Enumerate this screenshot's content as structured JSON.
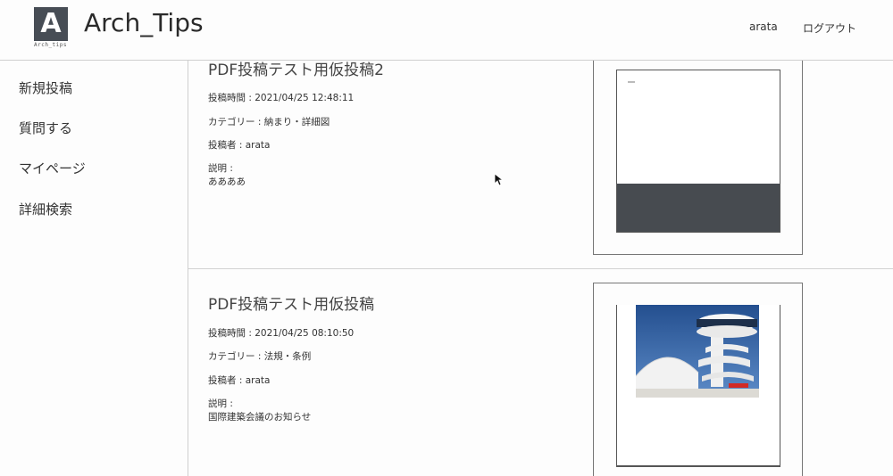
{
  "header": {
    "logo_letter": "A",
    "logo_sub": "Arch_tips",
    "site_title": "Arch_Tips",
    "user": "arata",
    "logout": "ログアウト"
  },
  "sidebar": {
    "items": [
      {
        "label": "新規投稿"
      },
      {
        "label": "質問する"
      },
      {
        "label": "マイページ"
      },
      {
        "label": "詳細検索"
      }
    ]
  },
  "posts": [
    {
      "title": "PDF投稿テスト用仮投稿2",
      "posted_at": "投稿時間 : 2021/04/25 12:48:11",
      "category": "カテゴリー : 納まり・詳細図",
      "author": "投稿者 : arata",
      "desc_label": "説明 :",
      "desc": "ああああ"
    },
    {
      "title": "PDF投稿テスト用仮投稿",
      "posted_at": "投稿時間 : 2021/04/25 08:10:50",
      "category": "カテゴリー : 法規・条例",
      "author": "投稿者 : arata",
      "desc_label": "説明 :",
      "desc": "国際建築会議のお知らせ"
    }
  ],
  "colors": {
    "logo_bg": "#474d55",
    "thumb_dark_band": "#474b50",
    "sky": "#2e63a8",
    "sign": "#d22a25"
  }
}
